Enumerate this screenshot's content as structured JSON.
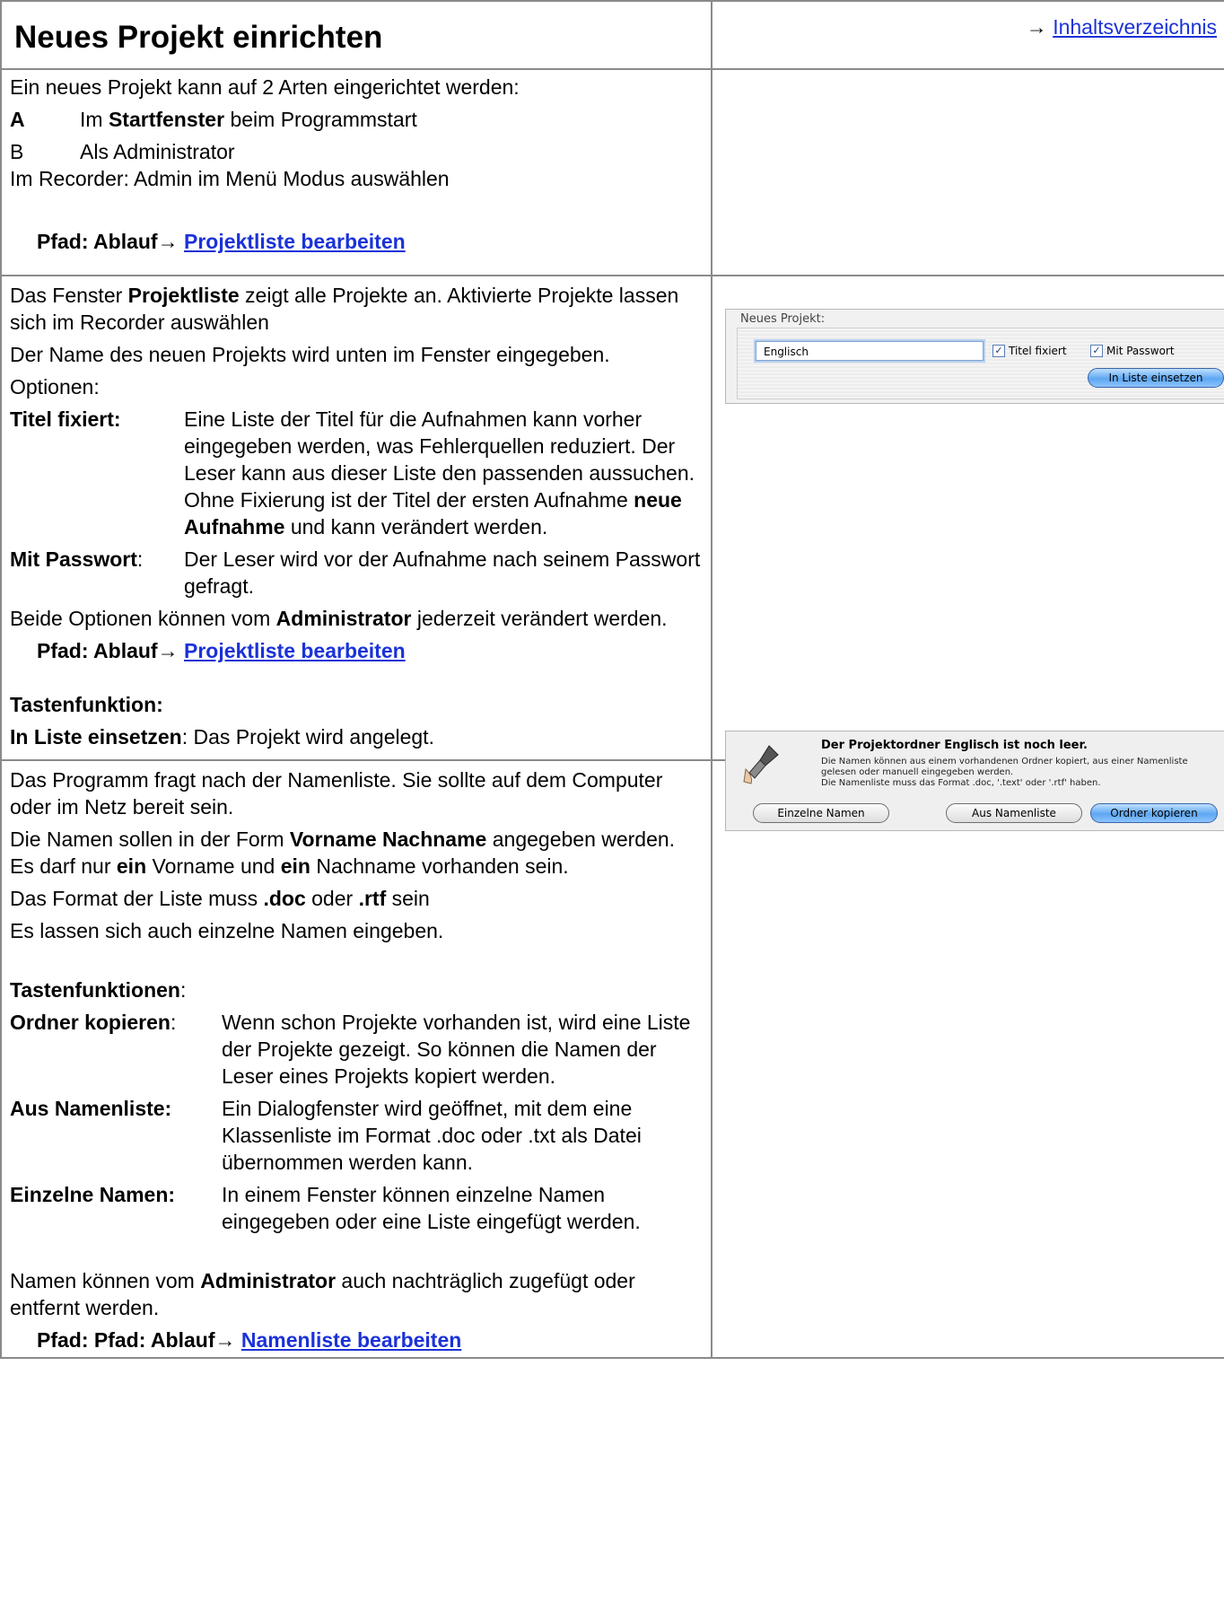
{
  "header": {
    "title": "Neues Projekt einrichten",
    "toc_arrow": "→ ",
    "toc_first": "I",
    "toc_rest": "nhaltsverzeichnis"
  },
  "section1": {
    "intro": "Ein neues Projekt kann auf 2 Arten eingerichtet werden:",
    "item_a_letter": "A",
    "item_a_pre": "Im ",
    "item_a_bold": "Startfenster",
    "item_a_post": " beim Programmstart",
    "item_b_letter": "B",
    "item_b_text": "Als Administrator",
    "recorder": "Im Recorder: Admin im Menü Modus auswählen",
    "path_label": "Pfad: Ablauf→ ",
    "path_link": "Projektliste bearbeiten"
  },
  "section2": {
    "p1_pre": "Das Fenster ",
    "p1_bold": "Projektliste",
    "p1_post": " zeigt alle Projekte an. Aktivierte Projekte lassen sich im Recorder auswählen",
    "p2": "Der Name des neuen Projekts wird unten im Fenster eingegeben.",
    "p3": "Optionen:",
    "opt1_term": "Titel fixiert:",
    "opt1_desc_a": "Eine Liste der Titel für die Aufnahmen kann vorher eingegeben werden, was Fehlerquellen reduziert. Der Leser kann aus dieser Liste den passenden aussuchen.",
    "opt1_desc_b_pre": "Ohne Fixierung ist der Titel der ersten Aufnahme ",
    "opt1_desc_b_bold": "neue Aufnahme",
    "opt1_desc_b_post": " und kann verändert werden.",
    "opt2_term": "Mit Passwort",
    "opt2_colon": ":",
    "opt2_desc": "Der Leser wird vor der Aufnahme nach seinem Passwort gefragt.",
    "p4_pre": "Beide Optionen können vom ",
    "p4_bold": "Administrator",
    "p4_post": " jederzeit verändert werden.",
    "path_label": "Pfad: Ablauf→ ",
    "path_link": "Projektliste bearbeiten",
    "keys_heading": "Tastenfunktion:",
    "key1_term": "In Liste einsetzen",
    "key1_desc": ": Das Projekt wird angelegt."
  },
  "screenshot1": {
    "legend": "Neues Projekt:",
    "input_value": "Englisch",
    "checkbox1_label": "Titel fixiert",
    "checkbox2_label": "Mit Passwort",
    "checkmark": "✓",
    "button_label": "In Liste einsetzen"
  },
  "section3": {
    "p1": "Das Programm fragt nach der Namenliste. Sie sollte auf dem Computer oder im Netz bereit sein.",
    "p2_pre": "Die Namen sollen in der Form ",
    "p2_bold": "Vorname Nachname",
    "p2_mid1": " angegeben werden. Es darf nur ",
    "p2_bold2": "ein",
    "p2_mid2": " Vorname und ",
    "p2_bold3": "ein",
    "p2_post": " Nachname vorhanden sein.",
    "p3_pre": "Das Format der Liste muss ",
    "p3_bold1": ".doc",
    "p3_mid": " oder ",
    "p3_bold2": ".rtf",
    "p3_post": " sein",
    "p4": "Es lassen sich auch einzelne Namen eingeben.",
    "keys_heading": "Tastenfunktionen",
    "keys_colon": ":",
    "key1_term": "Ordner kopieren",
    "key1_colon": ":",
    "key1_desc": "Wenn schon Projekte vorhanden ist, wird eine Liste der Projekte gezeigt. So können die Namen der Leser eines Projekts kopiert werden.",
    "key2_term": "Aus Namenliste:",
    "key2_desc": "Ein Dialogfenster wird geöffnet, mit dem eine Klassenliste im Format .doc oder .txt als Datei übernommen werden kann.",
    "key3_term": "Einzelne Namen:",
    "key3_desc": "In einem Fenster können einzelne Namen eingegeben oder eine Liste eingefügt werden.",
    "p5_pre": "Namen können vom ",
    "p5_bold": "Administrator",
    "p5_post": " auch nachträglich zugefügt oder entfernt werden.",
    "path_label": "Pfad: Pfad: Ablauf→ ",
    "path_link": "Namenliste bearbeiten"
  },
  "screenshot2": {
    "heading": "Der Projektordner Englisch ist noch leer.",
    "line1": "Die Namen können aus einem vorhandenen Ordner kopiert, aus einer Namenliste",
    "line2": "gelesen oder manuell eingegeben werden.",
    "line3": "Die Namenliste muss das Format .doc, '.text' oder '.rtf' haben.",
    "button1": "Einzelne Namen",
    "button2": "Aus Namenliste",
    "button3": "Ordner kopieren",
    "icon": "microphone-icon"
  }
}
